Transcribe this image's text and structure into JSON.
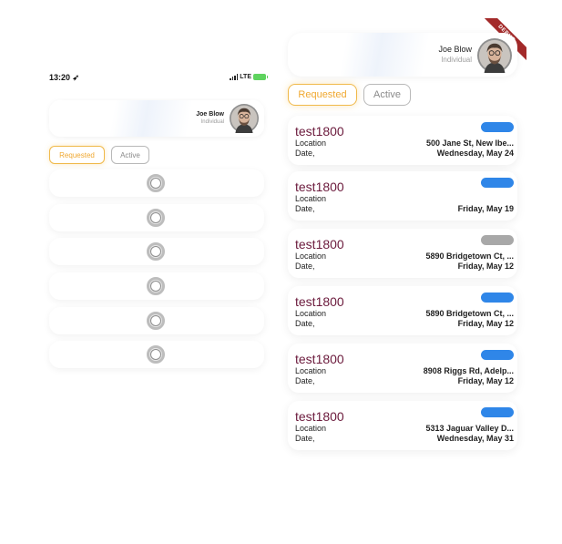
{
  "status_bar": {
    "time": "13:20",
    "network": "LTE"
  },
  "user": {
    "name": "Joe Blow",
    "role": "Individual"
  },
  "tabs": {
    "requested": "Requested",
    "active": "Active"
  },
  "debug_banner": "DEBUG",
  "left_screen": {
    "loading_rows": 6
  },
  "labels": {
    "location": "Location",
    "date": "Date,"
  },
  "colors": {
    "accent": "#f0a830",
    "title": "#6b1a3c",
    "pill_blue": "#2f86e8",
    "pill_gray": "#a8a8a8"
  },
  "requests": [
    {
      "title": "test1800",
      "location": "500 Jane St, New Ibe...",
      "date": "Wednesday, May 24",
      "status_color": "#2f86e8"
    },
    {
      "title": "test1800",
      "location": "",
      "date": "Friday, May 19",
      "status_color": "#2f86e8"
    },
    {
      "title": "test1800",
      "location": "5890 Bridgetown Ct, ...",
      "date": "Friday, May 12",
      "status_color": "#a8a8a8"
    },
    {
      "title": "test1800",
      "location": "5890 Bridgetown Ct, ...",
      "date": "Friday, May 12",
      "status_color": "#2f86e8"
    },
    {
      "title": "test1800",
      "location": "8908 Riggs Rd, Adelp...",
      "date": "Friday, May 12",
      "status_color": "#2f86e8"
    },
    {
      "title": "test1800",
      "location": "5313 Jaguar Valley D...",
      "date": "Wednesday, May 31",
      "status_color": "#2f86e8"
    }
  ]
}
